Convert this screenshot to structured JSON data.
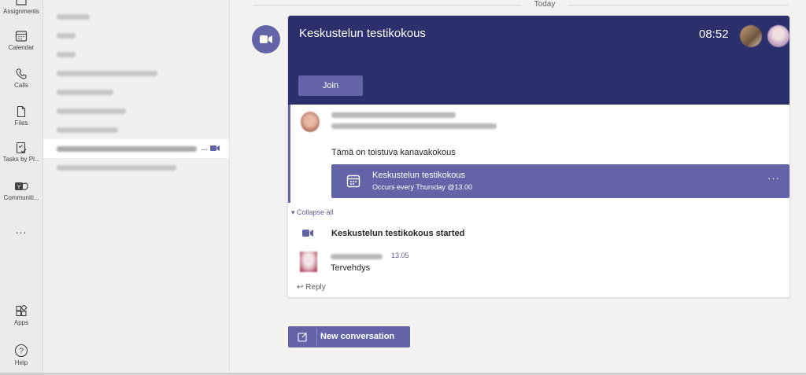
{
  "rail": {
    "items": [
      {
        "icon": "assignments-icon",
        "label": "Assignments"
      },
      {
        "icon": "calendar-icon",
        "label": "Calendar"
      },
      {
        "icon": "calls-icon",
        "label": "Calls"
      },
      {
        "icon": "files-icon",
        "label": "Files"
      },
      {
        "icon": "tasks-icon",
        "label": "Tasks by Pl..."
      },
      {
        "icon": "communities-icon",
        "label": "Communiti..."
      },
      {
        "icon": "more-icon",
        "label": "..."
      },
      {
        "icon": "apps-icon",
        "label": "Apps"
      },
      {
        "icon": "help-icon",
        "label": "Help"
      }
    ]
  },
  "channels": {
    "active_dots": "..."
  },
  "conversation": {
    "date_divider": "Today",
    "meeting_title": "Keskustelun testikokous",
    "meeting_time": "08:52",
    "join_label": "Join",
    "post_text": "Tämä on toistuva kanavakokous",
    "event_title": "Keskustelun testikokous",
    "event_recurrence": "Occurs every Thursday @13.00",
    "event_more": "···",
    "collapse_all": "Collapse all",
    "started_text": "Keskustelun testikokous started",
    "reply_time": "13.05",
    "reply_text": "Tervehdys",
    "reply_label": "Reply",
    "new_conversation_label": "New conversation"
  },
  "colors": {
    "accent": "#6264a7",
    "banner": "#2b2f6b"
  }
}
